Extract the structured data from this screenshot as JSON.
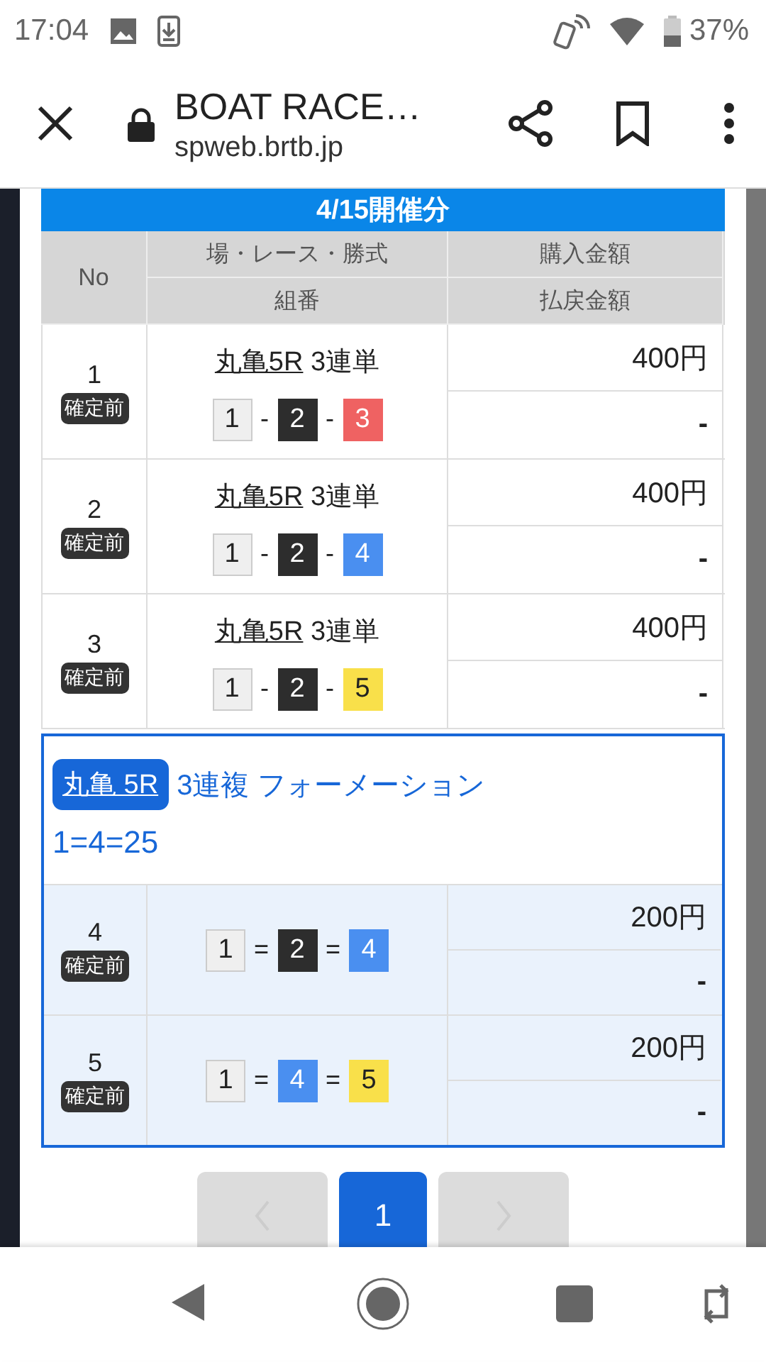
{
  "status_bar": {
    "time": "17:04",
    "battery": "37%"
  },
  "browser": {
    "title": "BOAT RACE…",
    "url": "spweb.brtb.jp"
  },
  "banner": "4/15開催分",
  "columns": {
    "no": "No",
    "race": "場・レース・勝式",
    "combination": "組番",
    "amount": "購入金額",
    "payout": "払戻金額"
  },
  "entries": [
    {
      "kind": "single",
      "no": "1",
      "status": "確定前",
      "race": "丸亀5R",
      "bet_type": "3連単",
      "separator": "-",
      "boats": [
        {
          "number": "1",
          "color": "#efefef"
        },
        {
          "number": "2",
          "color": "#2d2d2d"
        },
        {
          "number": "3",
          "color": "#ef6262"
        }
      ],
      "amount": "400円",
      "payout": "-"
    },
    {
      "kind": "single",
      "no": "2",
      "status": "確定前",
      "race": "丸亀5R",
      "bet_type": "3連単",
      "separator": "-",
      "boats": [
        {
          "number": "1",
          "color": "#efefef"
        },
        {
          "number": "2",
          "color": "#2d2d2d"
        },
        {
          "number": "4",
          "color": "#4a8ff0"
        }
      ],
      "amount": "400円",
      "payout": "-"
    },
    {
      "kind": "single",
      "no": "3",
      "status": "確定前",
      "race": "丸亀5R",
      "bet_type": "3連単",
      "separator": "-",
      "boats": [
        {
          "number": "1",
          "color": "#efefef"
        },
        {
          "number": "2",
          "color": "#2d2d2d"
        },
        {
          "number": "5",
          "color": "#f9e04a"
        }
      ],
      "amount": "400円",
      "payout": "-"
    },
    {
      "kind": "group",
      "race": "丸亀 5R",
      "bet_type": "3連複 フォーメーション",
      "formation": "1=4=25",
      "rows": [
        {
          "no": "4",
          "status": "確定前",
          "separator": "=",
          "boats": [
            {
              "number": "1",
              "color": "#efefef"
            },
            {
              "number": "2",
              "color": "#2d2d2d"
            },
            {
              "number": "4",
              "color": "#4a8ff0"
            }
          ],
          "amount": "200円",
          "payout": "-"
        },
        {
          "no": "5",
          "status": "確定前",
          "separator": "=",
          "boats": [
            {
              "number": "1",
              "color": "#efefef"
            },
            {
              "number": "4",
              "color": "#4a8ff0"
            },
            {
              "number": "5",
              "color": "#f9e04a"
            }
          ],
          "amount": "200円",
          "payout": "-"
        }
      ]
    }
  ],
  "pager": {
    "prev_disabled": true,
    "pages": [
      {
        "label": "1",
        "selected": true
      }
    ],
    "next_disabled": true
  }
}
